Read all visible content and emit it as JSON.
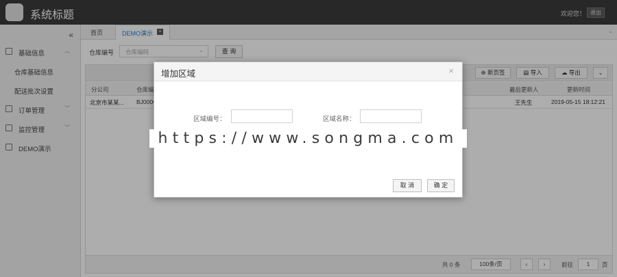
{
  "header": {
    "title": "系统标题",
    "welcome": "欢迎您！",
    "logout": "退出"
  },
  "sidebar": {
    "collapse": "«",
    "items": [
      {
        "label": "基础信息",
        "icon": "folder-icon"
      },
      {
        "label": "订单管理",
        "icon": "folder-icon"
      },
      {
        "label": "监控管理",
        "icon": "folder-icon"
      },
      {
        "label": "DEMO演示",
        "icon": "file-icon"
      }
    ],
    "sub_items": [
      "仓库基础信息",
      "配送批次设置"
    ]
  },
  "tabs": {
    "home": "首页",
    "active": "DEMO演示",
    "close": "×",
    "more": "⌄"
  },
  "filter": {
    "label": "仓库编号",
    "placeholder": "仓库编码",
    "query_button": "查 询"
  },
  "toolbar": {
    "add_tab": "⊕ 新页签",
    "import": "▤ 导入",
    "export": "☁ 导出",
    "more": "⌄"
  },
  "table": {
    "columns": [
      "分公司",
      "仓库编号",
      "最后更新人",
      "更新时间"
    ],
    "rows": [
      {
        "company": "北京市某某...",
        "code": "BJ0000",
        "updater": "王先生",
        "updated": "2019-05-15 18:12:21"
      }
    ]
  },
  "pager": {
    "total": "共 0 条",
    "page_size": "100条/页",
    "prev": "‹",
    "next": "›",
    "goto": "前往",
    "page": "1",
    "unit": "页"
  },
  "modal": {
    "title": "增加区域",
    "close": "×",
    "field1_label": "区域编号：",
    "field2_label": "区域名称：",
    "cancel": "取 消",
    "confirm": "确 定"
  },
  "watermark": "https://www.songma.com"
}
